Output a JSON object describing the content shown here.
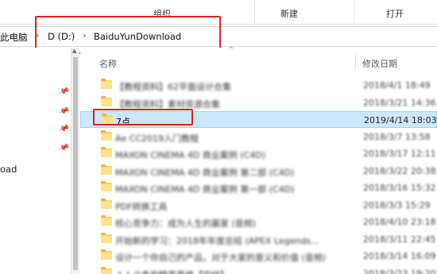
{
  "ribbon": {
    "organize_label": "组织",
    "new_label": "新建",
    "open_label": "打开"
  },
  "address": {
    "crumbs": [
      "此电脑",
      "D (D:)",
      "BaiduYunDownload"
    ],
    "separator": "›"
  },
  "navigation": {
    "partial_item_label": "oad"
  },
  "list": {
    "columns": {
      "name": "名称",
      "date_modified": "修改日期"
    },
    "rows": [
      {
        "name": "【教程资料】62平面设计合集",
        "date": "2018/4/1 18:49",
        "selected": false,
        "readable": false
      },
      {
        "name": "【教程资料】素材资源合集",
        "date": "2018/3/21 14:36",
        "selected": false,
        "readable": false
      },
      {
        "name": "7点",
        "date": "2019/4/14 18:03",
        "selected": true,
        "readable": true
      },
      {
        "name": "Ae CC2019入门教程",
        "date": "2018/3/7 13:58",
        "selected": false,
        "readable": false
      },
      {
        "name": "MAXON CINEMA 4D 商业案例 (C4D)",
        "date": "2018/3/17 12:11",
        "selected": false,
        "readable": false
      },
      {
        "name": "MAXON CINEMA 4D 商业案例 第二部 (C4D)",
        "date": "2018/3/22 20:38",
        "selected": false,
        "readable": false
      },
      {
        "name": "MAXON CINEMA 4D 商业案例 第一部 (C4D)",
        "date": "2018/3/16 15:32",
        "selected": false,
        "readable": false
      },
      {
        "name": "PDF转换工具",
        "date": "2018/3/3 15:29",
        "selected": false,
        "readable": false
      },
      {
        "name": "核心竞争力：成为人生的赢家 (音频)",
        "date": "2018/4/10 23:18",
        "selected": false,
        "readable": false
      },
      {
        "name": "开始新的学习：2018年年度总结 (APEX Legends...",
        "date": "2018/3/11 22:45",
        "selected": false,
        "readable": false
      },
      {
        "name": "设计一个你自己的产品，对于大家的意义和价值 (音频)",
        "date": "2018/3/14 16:09",
        "selected": false,
        "readable": false
      },
      {
        "name": "人人必备的精英思维【完结】",
        "date": "2018/3/23 19:20",
        "selected": false,
        "readable": false
      }
    ]
  },
  "colors": {
    "selection_bg": "#cce8ff",
    "selection_border": "#99d1ff",
    "annotation_red": "#e02020",
    "folder_yellow": "#ffe28a"
  }
}
